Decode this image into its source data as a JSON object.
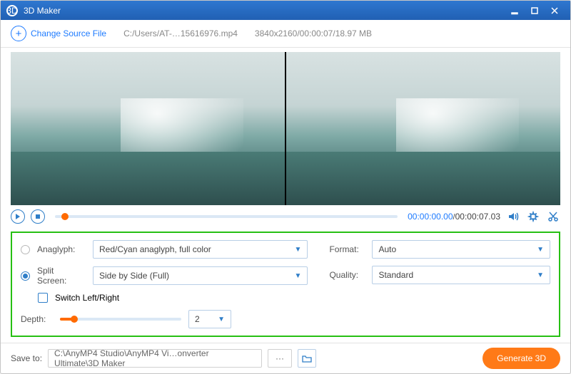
{
  "titlebar": {
    "title": "3D Maker"
  },
  "toolbar": {
    "change_source": "Change Source File",
    "file_path": "C:/Users/AT-…15616976.mp4",
    "file_info": "3840x2160/00:00:07/18.97 MB"
  },
  "player": {
    "current": "00:00:00.00",
    "total": "00:00:07.03"
  },
  "settings": {
    "anaglyph_label": "Anaglyph:",
    "anaglyph_value": "Red/Cyan anaglyph, full color",
    "split_label": "Split Screen:",
    "split_value": "Side by Side (Full)",
    "switch_label": "Switch Left/Right",
    "depth_label": "Depth:",
    "depth_value": "2",
    "format_label": "Format:",
    "format_value": "Auto",
    "quality_label": "Quality:",
    "quality_value": "Standard",
    "mode": "split"
  },
  "footer": {
    "save_label": "Save to:",
    "save_path": "C:\\AnyMP4 Studio\\AnyMP4 Vi…onverter Ultimate\\3D Maker",
    "generate": "Generate 3D"
  }
}
